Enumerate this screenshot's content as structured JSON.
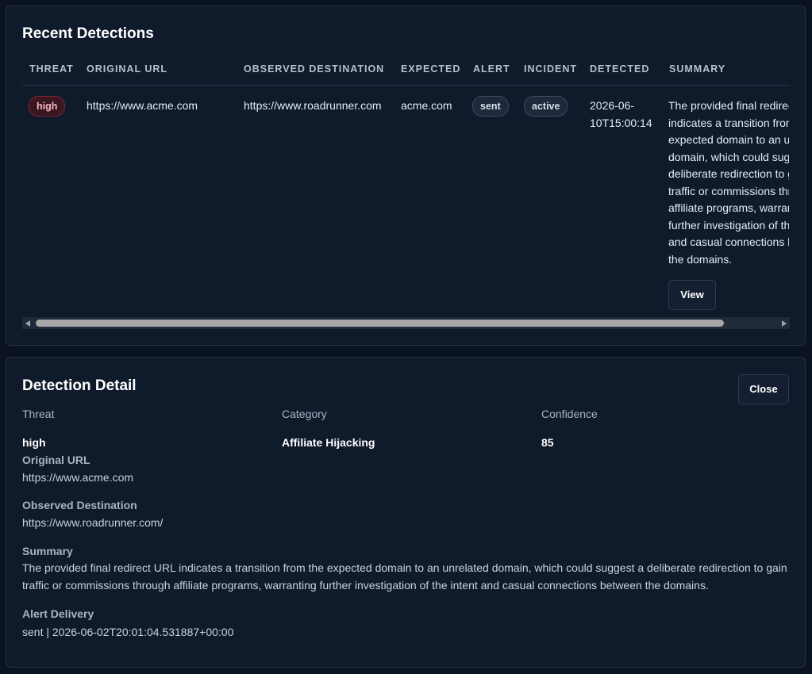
{
  "detections": {
    "title": "Recent Detections",
    "columns": [
      "THREAT",
      "ORIGINAL URL",
      "OBSERVED DESTINATION",
      "EXPECTED",
      "ALERT",
      "INCIDENT",
      "DETECTED",
      "SUMMARY"
    ],
    "rows": [
      {
        "threat": "high",
        "original_url": "https://www.acme.com",
        "observed_destination": "https://www.roadrunner.com",
        "expected": "acme.com",
        "alert": "sent",
        "incident": "active",
        "detected_line1": "2026-06-",
        "detected_line2": "10T15:00:14",
        "summary_lines": [
          "The provided final redirect URL",
          "indicates a transition from the",
          "expected domain to an unrelated",
          "domain, which could suggest a",
          "deliberate redirection to gain",
          "traffic or commissions through",
          "affiliate programs, warranting",
          "further investigation of the intent",
          "and casual connections between",
          "the domains."
        ],
        "view_label": "View"
      }
    ]
  },
  "detail": {
    "title": "Detection Detail",
    "close_label": "Close",
    "threat_label": "Threat",
    "threat_value": "high",
    "category_label": "Category",
    "category_value": "Affiliate Hijacking",
    "confidence_label": "Confidence",
    "confidence_value": "85",
    "original_url_label": "Original URL",
    "original_url_value": "https://www.acme.com",
    "observed_label": "Observed Destination",
    "observed_value": "https://www.roadrunner.com/",
    "summary_label": "Summary",
    "summary_value": "The provided final redirect URL indicates a transition from the expected domain to an unrelated domain, which could suggest a deliberate redirection to gain traffic or commissions through affiliate programs, warranting further investigation of the intent and casual connections between the domains.",
    "alert_delivery_label": "Alert Delivery",
    "alert_delivery_value": "sent | 2026-06-02T20:01:04.531887+00:00"
  },
  "colors": {
    "page_bg": "#0b1220",
    "panel_bg": "#0f1a2b",
    "threat_badge_bg": "#3a1620",
    "threat_badge_text": "#f4b8c4"
  }
}
